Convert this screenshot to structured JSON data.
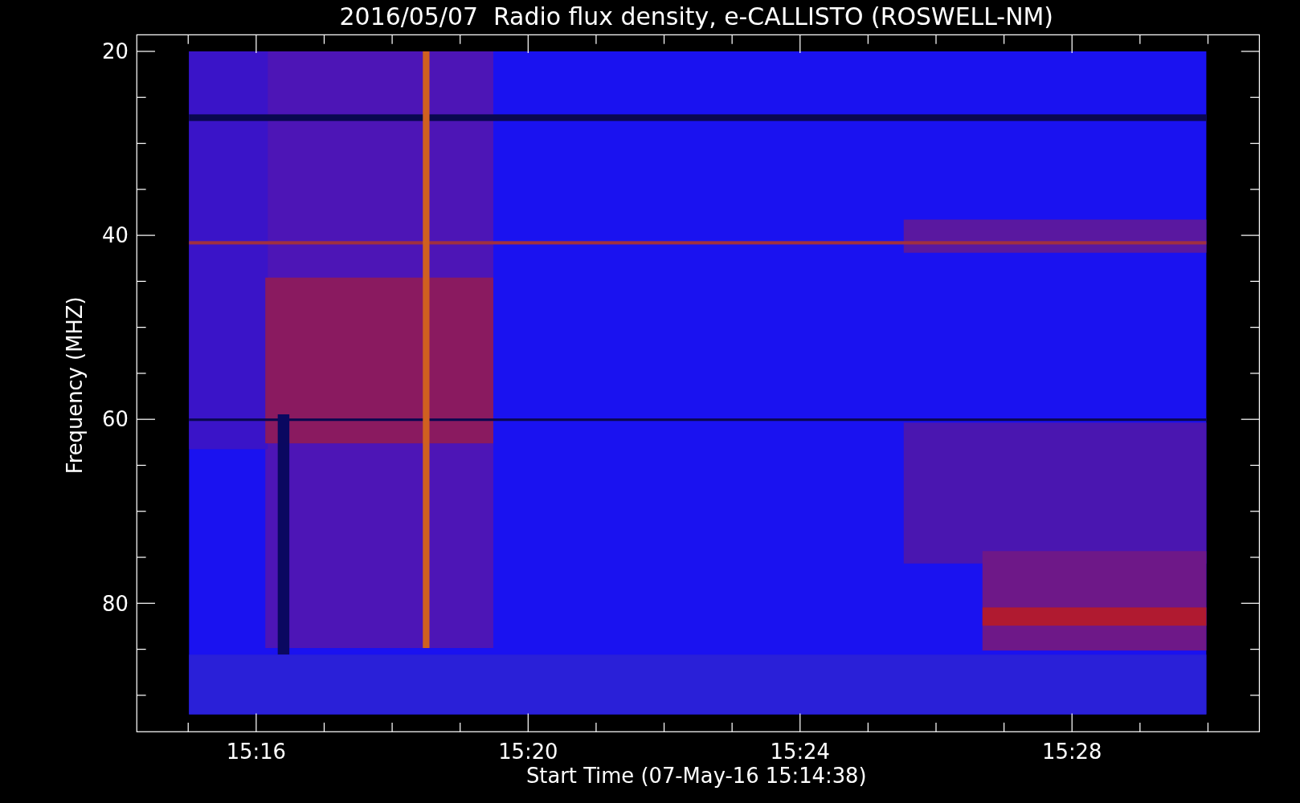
{
  "title": "2016/05/07  Radio flux density, e-CALLISTO (ROSWELL-NM)",
  "ylabel": "Frequency (MHZ)",
  "xlabel": "Start Time (07-May-16 15:14:38)",
  "yticks": [
    "20",
    "40",
    "60",
    "80"
  ],
  "xticks": [
    "15:16",
    "15:20",
    "15:24",
    "15:28"
  ]
}
